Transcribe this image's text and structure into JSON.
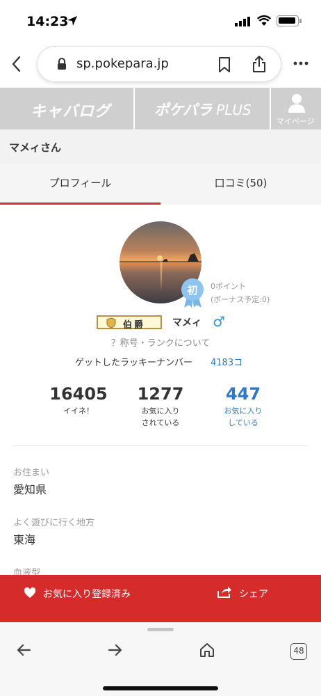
{
  "status": {
    "time": "14:23"
  },
  "browser": {
    "url": "sp.pokepara.jp",
    "tab_count": "48"
  },
  "site_nav": {
    "logo_left": "キャバログ",
    "logo_right_main": "ポケパラ",
    "logo_right_sub": "PLUS",
    "mypage": "マイページ"
  },
  "profile_header": {
    "name": "マメィさん"
  },
  "tabs": [
    {
      "label": "プロフィール",
      "active": true
    },
    {
      "label": "口コミ(50)",
      "active": false
    }
  ],
  "profile": {
    "badge_first": "初",
    "points": "0ポイント",
    "bonus": "(ボーナス予定:0)",
    "rank_title": "伯爵",
    "handle": "マメィ",
    "gender_symbol": "♂",
    "rank_link": "？称号・ランクについて",
    "lucky_label": "ゲットしたラッキーナンバー",
    "lucky_value": "4183コ"
  },
  "stats": [
    {
      "value": "16405",
      "label1": "イイネ！",
      "label2": ""
    },
    {
      "value": "1277",
      "label1": "お気に入り",
      "label2": "されている"
    },
    {
      "value": "447",
      "label1": "お気に入り",
      "label2": "している"
    }
  ],
  "fields": [
    {
      "label": "お住まい",
      "value": "愛知県"
    },
    {
      "label": "よく遊びに行く地方",
      "value": "東海"
    },
    {
      "label": "血液型",
      "value": ""
    }
  ],
  "actions": {
    "favorite": "お気に入り登録済み",
    "share": "シェア"
  },
  "colors": {
    "accent_red": "#d52b2b",
    "link_blue": "#2f77c8",
    "nav_gray": "#cfcfcf"
  }
}
